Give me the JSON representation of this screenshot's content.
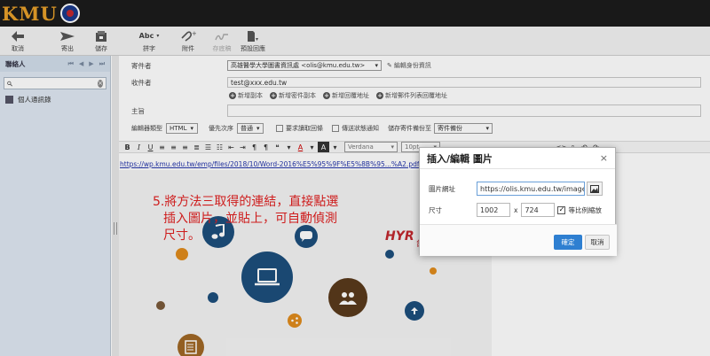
{
  "app": {
    "logo_text": "KMU"
  },
  "toolbar": {
    "discard": "取消",
    "send": "寄出",
    "save": "儲存",
    "spell": "拼字",
    "attach": "附件",
    "draft": "存底稿",
    "preview": "預設回應"
  },
  "sidebar": {
    "title": "聯絡人",
    "search_placeholder": "",
    "items": [
      {
        "label": "個人通訊錄"
      }
    ]
  },
  "compose": {
    "from_label": "寄件者",
    "from_value": "高雄醫學大學圖書資訊處 <olis@kmu.edu.tw>",
    "edit_identity": "編輯身份資訊",
    "to_label": "收件者",
    "to_value": "test@xxx.edu.tw",
    "add_cc": "新增副本",
    "add_bcc": "新增密件副本",
    "add_reply_to": "新增回覆地址",
    "add_followup": "新增郵件列表回覆地址",
    "subject_label": "主旨",
    "subject_value": "",
    "editor_type_label": "編輯器類型",
    "editor_type_value": "HTML",
    "priority_label": "優先次序",
    "priority_value": "普通",
    "read_receipt": "要求讀取回條",
    "delivery_status": "傳送狀態通知",
    "save_sent_label": "儲存寄件備份至",
    "save_sent_value": "寄件備份"
  },
  "format_bar": {
    "font_name": "Verdana",
    "font_size": "10pt"
  },
  "editor": {
    "link_text": "https://wp.kmu.edu.tw/emp/files/2018/10/Word-2016%E5%95%9F%E5%8B%95...%A2.pdf",
    "annotation_line1": "5.將方法三取得的連結，直接點選",
    "annotation_line2": "插入圖片，並貼上，可自動偵測",
    "annotation_line3": "尺寸。",
    "banner_text": "HYR",
    "banner_sub": "台"
  },
  "dialog": {
    "title": "插入/編輯 圖片",
    "close": "×",
    "url_label": "圖片網址",
    "url_value": "https://olis.kmu.edu.tw/images/",
    "size_label": "尺寸",
    "width": "1002",
    "x_sep": "x",
    "height": "724",
    "keep_ratio": "等比例縮放",
    "ok": "確定",
    "cancel": "取消"
  },
  "colors": {
    "accent": "#2e7fd1",
    "annotation": "#e02020",
    "topbar": "#1c1c1c"
  }
}
